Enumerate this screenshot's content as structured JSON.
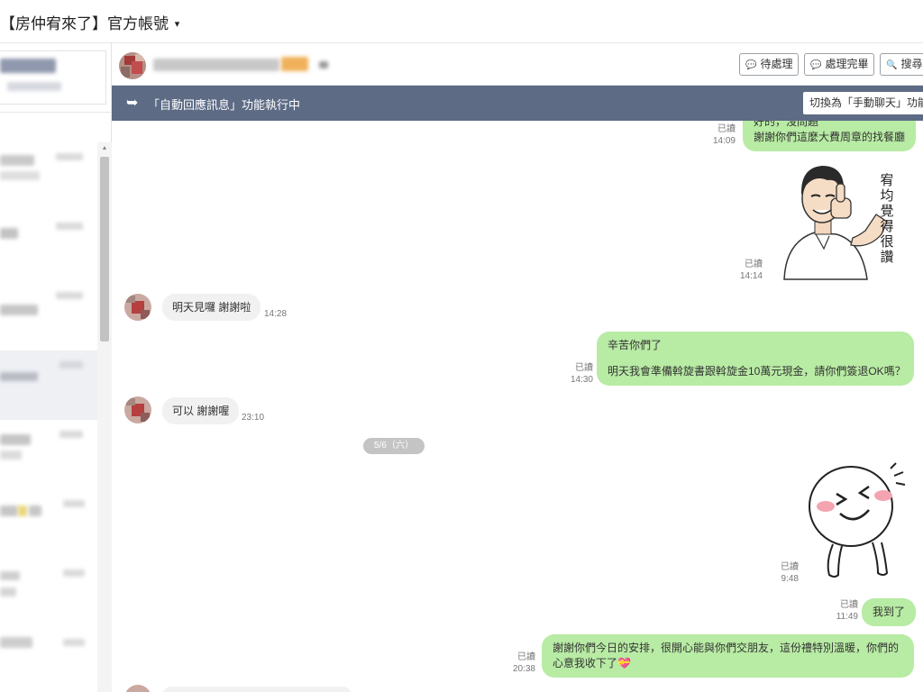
{
  "app": {
    "account_title": "【房仲宥來了】官方帳號",
    "caret": "▾"
  },
  "header": {
    "buttons": [
      {
        "icon": "speech-bubble-icon",
        "glyph": "💬",
        "label": "待處理"
      },
      {
        "icon": "check-bubble-icon",
        "glyph": "💬",
        "label": "處理完畢"
      },
      {
        "icon": "search-icon",
        "glyph": "🔍",
        "label": "搜尋"
      }
    ]
  },
  "auto_reply": {
    "arrow": "➥",
    "status_text": "「自動回應訊息」功能執行中",
    "switch_label": "切換為「手動聊天」功能"
  },
  "messages": [
    {
      "side": "out",
      "lines": [
        "好的，沒問題",
        "謝謝你們這麼大費周章的找餐廳"
      ],
      "read": "已讀",
      "time": "14:09"
    },
    {
      "side": "out",
      "type": "sticker",
      "sticker": "thumbs-up-man",
      "caption": "宥均覺得很讚",
      "read": "已讀",
      "time": "14:14"
    },
    {
      "side": "in",
      "lines": [
        "明天見囉 謝謝啦"
      ],
      "time": "14:28"
    },
    {
      "side": "out",
      "lines": [
        "辛苦你們了",
        "明天我會準備斡旋書跟斡旋金10萬元現金，請你們簽退OK嗎？"
      ],
      "read": "已讀",
      "time": "14:30"
    },
    {
      "side": "in",
      "lines": [
        "可以 謝謝喔"
      ],
      "time": "23:10"
    },
    {
      "side": "out",
      "type": "sticker",
      "sticker": "laughing-face",
      "read": "已讀",
      "time": "9:48"
    },
    {
      "side": "out",
      "lines": [
        "我到了"
      ],
      "read": "已讀",
      "time": "11:49"
    },
    {
      "side": "out",
      "lines": [
        "謝謝你們今日的安排，很開心能與你們交朋友，這份禮特別溫暖，你們的",
        "心意我收下了💝"
      ],
      "read": "已讀",
      "time": "20:38"
    }
  ],
  "date_divider": "5/6（六）",
  "colors": {
    "header_bar": "#5d6b85",
    "outgoing_bubble": "#b8eba4",
    "incoming_bubble": "#f1f1f1"
  }
}
